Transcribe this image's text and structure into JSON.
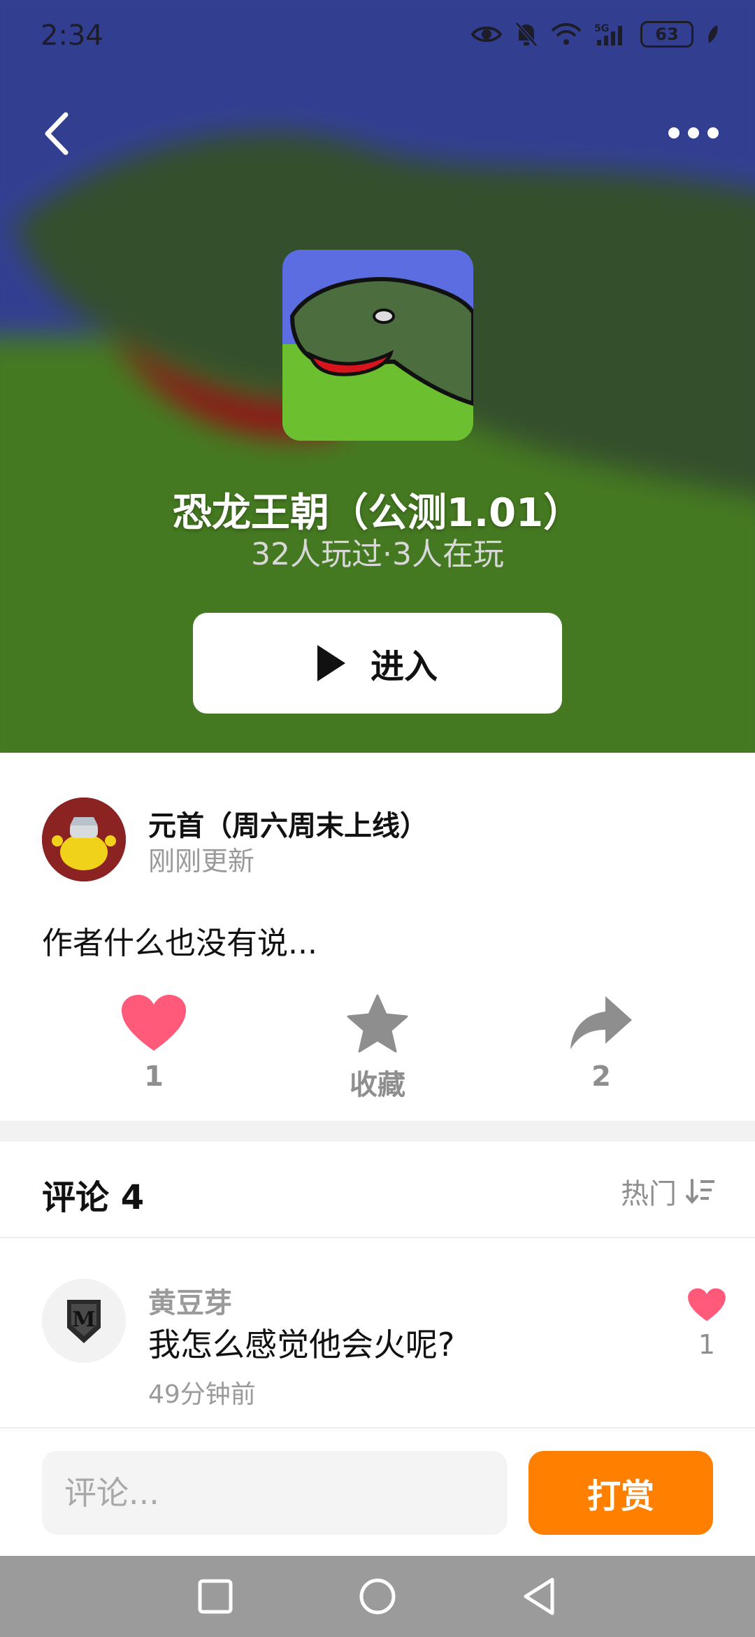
{
  "status_bar": {
    "time": "2:34",
    "battery": "63",
    "icons": [
      "eye-icon",
      "mute-bell-icon",
      "wifi-icon",
      "5g-signal-icon",
      "battery-icon",
      "leaf-icon"
    ]
  },
  "header": {
    "back_icon": "chevron-left-icon",
    "more_icon": "more-dots-icon"
  },
  "game": {
    "title": "恐龙王朝（公测1.01）",
    "stats": "32人玩过·3人在玩",
    "enter_label": "进入",
    "icon": "dinosaur-game-icon"
  },
  "author": {
    "name": "元首（周六周末上线）",
    "updated": "刚刚更新",
    "description": "作者什么也没有说..."
  },
  "actions": {
    "like_count": "1",
    "favorite_label": "收藏",
    "share_count": "2"
  },
  "comments": {
    "title": "评论 4",
    "sort_label": "热门",
    "items": [
      {
        "user": "黄豆芽",
        "text": "我怎么感觉他会火呢?",
        "time": "49分钟前",
        "likes": "1"
      }
    ]
  },
  "input_bar": {
    "placeholder": "评论...",
    "tip_label": "打赏"
  },
  "colors": {
    "like_pink": "#ff5a7a",
    "tip_orange": "#ff8000",
    "hero_sky": "#3a49a0",
    "hero_grass": "#4f8a26",
    "muted_gray": "#8e8e8e"
  }
}
